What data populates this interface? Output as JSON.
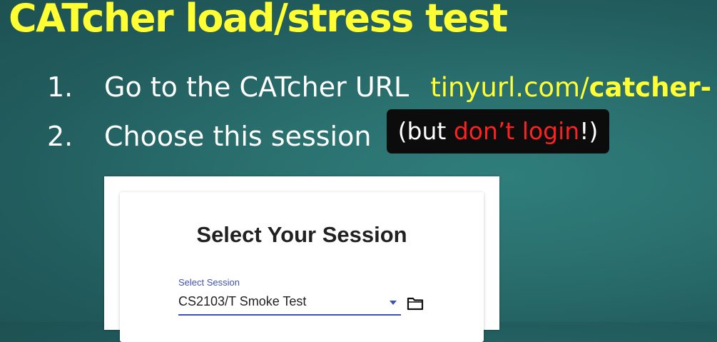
{
  "slide": {
    "title": "CATcher load/stress test",
    "steps": [
      {
        "number": "1.",
        "text": "Go to the CATcher URL",
        "url_prefix": "tinyurl.com/",
        "url_bold": "catcher-"
      },
      {
        "number": "2.",
        "text": "Choose this session"
      }
    ],
    "note": {
      "open": "(but ",
      "highlight": "don’t login",
      "close": "!)"
    }
  },
  "screenshot": {
    "card_title": "Select Your Session",
    "select_label": "Select Session",
    "select_value": "CS2103/T Smoke Test",
    "icons": {
      "dropdown": "chevron-down-icon",
      "folder": "folder-icon"
    }
  },
  "colors": {
    "background": "#2a706f",
    "title": "#ffff33",
    "body_text": "#ffffff",
    "note_background": "#0c0c0c",
    "note_highlight": "#ff2020",
    "accent": "#3f51b5"
  }
}
